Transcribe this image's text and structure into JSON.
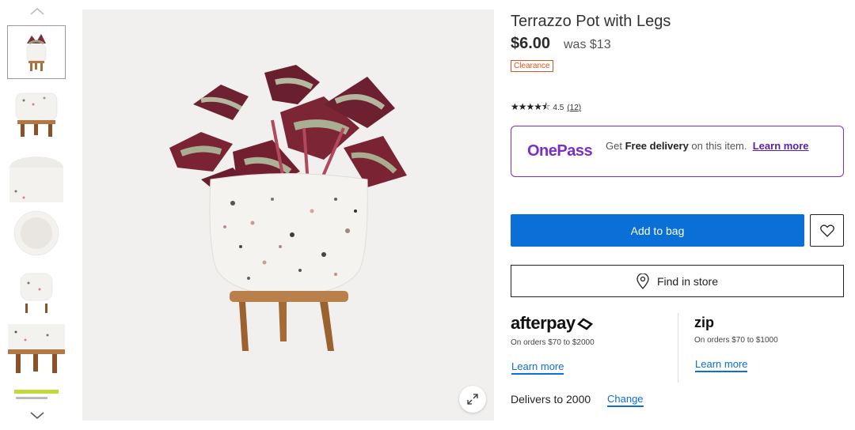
{
  "product": {
    "title": "Terrazzo Pot with Legs",
    "price": "$6.00",
    "was_price": "was $13",
    "badge": "Clearance",
    "rating": "4.5",
    "review_count": "(12)"
  },
  "onepass": {
    "logo": "OnePass",
    "text_prefix": "Get ",
    "text_bold": "Free delivery",
    "text_suffix": " on this item.",
    "link": "Learn more"
  },
  "actions": {
    "add_to_bag": "Add to bag",
    "find_in_store": "Find in store"
  },
  "afterpay": {
    "logo": "afterpay",
    "note": "On orders $70 to $2000",
    "link": "Learn more"
  },
  "zip": {
    "logo": "zip",
    "note": "On orders $70 to $1000",
    "link": "Learn more"
  },
  "delivery": {
    "text": "Delivers to 2000",
    "change": "Change"
  },
  "colors": {
    "accent_blue": "#0a6fd6",
    "onepass_purple": "#7b2fc9",
    "clearance_orange": "#d9531e"
  }
}
